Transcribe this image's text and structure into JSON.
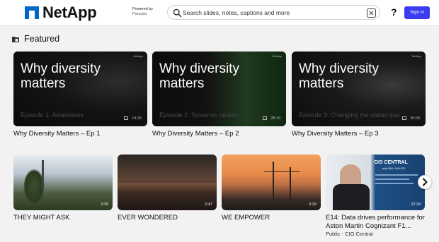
{
  "header": {
    "brand": "NetApp",
    "powered_line1": "Powered by",
    "powered_line2": "Panopto",
    "search_placeholder": "Search slides, notes, captions and more",
    "help_label": "?",
    "signin_label": "Sign in"
  },
  "featured": {
    "title": "Featured",
    "items": [
      {
        "title": "Why Diversity Matters – Ep 1",
        "big_text": "Why diversity matters",
        "episode": "Episode 1: Awareness",
        "badge": "NetApp",
        "duration": "14:25"
      },
      {
        "title": "Why Diversity Matters – Ep 2",
        "big_text": "Why diversity matters",
        "episode": "Episode 2: Systemic racism",
        "badge": "NetApp",
        "duration": "28:19"
      },
      {
        "title": "Why Diversity Matters – Ep 3",
        "big_text": "Why diversity matters",
        "episode": "Episode 3: Changing the status quo",
        "badge": "NetApp",
        "duration": "30:00"
      }
    ]
  },
  "videos": [
    {
      "title": "THEY MIGHT ASK",
      "duration": "3:39",
      "subtitle": ""
    },
    {
      "title": "EVER WONDERED",
      "duration": "0:47",
      "subtitle": ""
    },
    {
      "title": "WE EMPOWER",
      "duration": "0:29",
      "subtitle": ""
    },
    {
      "title_line1": "E14: Data drives performance for",
      "title_line2": "Aston Martin Cognizant F1...",
      "duration": "22:34",
      "subtitle": "Public - CIO Central",
      "thumb_brand": "CIO CENTRAL",
      "thumb_host": "with BILL MILLER"
    }
  ],
  "colors": {
    "brand": "#0067c5",
    "signin_bg": "#3b3bf2",
    "page_bg": "#f2f2f2"
  },
  "icons": [
    "search-icon",
    "clear-icon",
    "help-icon",
    "folder-icon",
    "slides-icon",
    "chevron-right-icon"
  ]
}
